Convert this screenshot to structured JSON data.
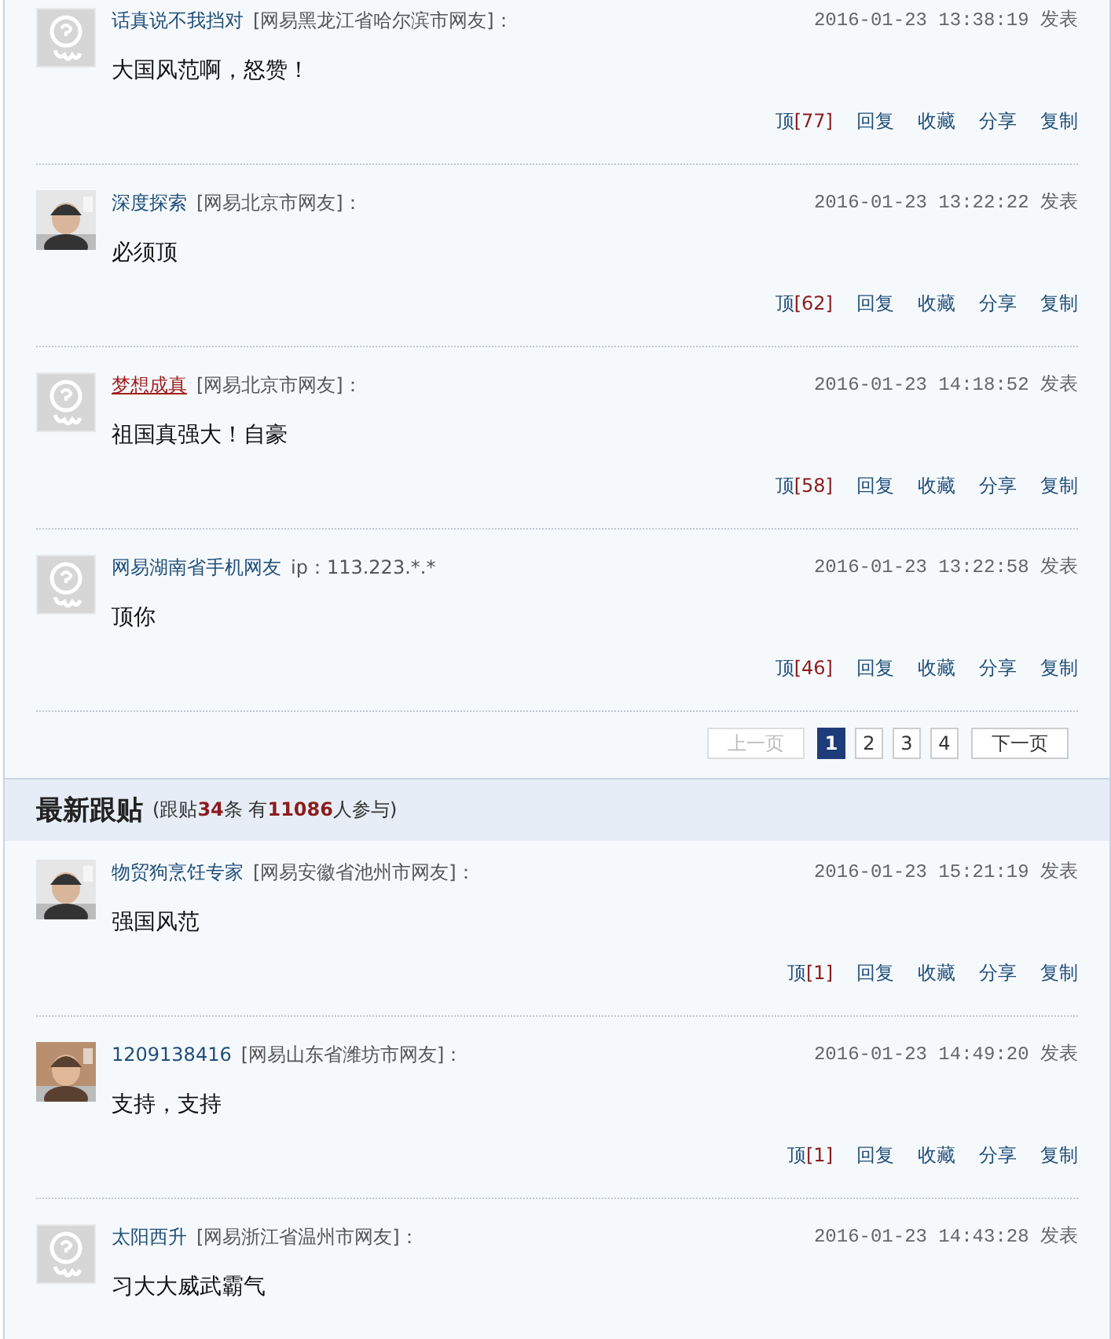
{
  "hot_comments": [
    {
      "avatar": {
        "kind": "default"
      },
      "name": "话真说不我挡对",
      "name_highlighted": false,
      "origin": "[网易黑龙江省哈尔滨市网友]：",
      "time": "2016-01-23 13:38:19 发表",
      "body": "大国风范啊，怒赞！",
      "vote": {
        "label": "顶",
        "count": "[77]"
      },
      "actions": [
        "回复",
        "收藏",
        "分享",
        "复制"
      ]
    },
    {
      "name": "深度探索",
      "name_highlighted": false,
      "origin": "[网易北京市网友]：",
      "time": "2016-01-23 13:22:22 发表",
      "body": "必须顶",
      "vote": {
        "label": "顶",
        "count": "[62]"
      },
      "actions": [
        "回复",
        "收藏",
        "分享",
        "复制"
      ]
    },
    {
      "avatar": {
        "kind": "default"
      },
      "name": "梦想成真",
      "name_highlighted": true,
      "origin": "[网易北京市网友]：",
      "time": "2016-01-23 14:18:52 发表",
      "body": "祖国真强大！自豪",
      "vote": {
        "label": "顶",
        "count": "[58]"
      },
      "actions": [
        "回复",
        "收藏",
        "分享",
        "复制"
      ]
    },
    {
      "avatar": {
        "kind": "default"
      },
      "name": "网易湖南省手机网友",
      "name_highlighted": false,
      "origin": "ip：113.223.*.*",
      "time": "2016-01-23 13:22:58 发表",
      "body": "顶你",
      "vote": {
        "label": "顶",
        "count": "[46]"
      },
      "actions": [
        "回复",
        "收藏",
        "分享",
        "复制"
      ]
    }
  ],
  "pagination": {
    "previous": {
      "label": "上一页",
      "disabled": true
    },
    "pages": [
      {
        "label": "1",
        "selected": true
      },
      {
        "label": "2",
        "selected": false
      },
      {
        "label": "3",
        "selected": false
      },
      {
        "label": "4",
        "selected": false
      }
    ],
    "next": {
      "label": "下一页",
      "disabled": false
    }
  },
  "latest_section": {
    "title": "最新跟贴",
    "summary": "(跟贴**34**条 有**11086**人参与)"
  },
  "latest_comments": [
    {
      "name": "物贸狗烹饪专家",
      "name_highlighted": false,
      "origin": "[网易安徽省池州市网友]：",
      "time": "2016-01-23 15:21:19 发表",
      "body": "强国风范",
      "vote": {
        "label": "顶",
        "count": "[1]"
      },
      "actions": [
        "回复",
        "收藏",
        "分享",
        "复制"
      ]
    },
    {
      "name": "1209138416",
      "name_highlighted": false,
      "origin": "[网易山东省潍坊市网友]：",
      "time": "2016-01-23 14:49:20 发表",
      "body": "支持，支持",
      "vote": {
        "label": "顶",
        "count": "[1]"
      },
      "actions": [
        "回复",
        "收藏",
        "分享",
        "复制"
      ]
    },
    {
      "avatar": {
        "kind": "default"
      },
      "name": "太阳西升",
      "name_highlighted": false,
      "origin": "[网易浙江省温州市网友]：",
      "time": "2016-01-23 14:43:28 发表",
      "body": "习大大威武霸气"
    }
  ]
}
